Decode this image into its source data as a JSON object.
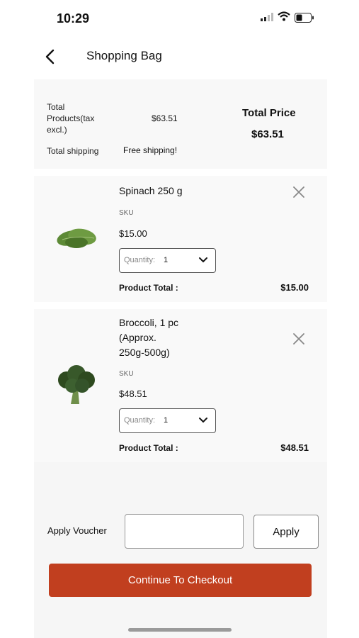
{
  "status_bar": {
    "time": "10:29"
  },
  "header": {
    "title": "Shopping Bag"
  },
  "summary": {
    "total_products_label": "Total\nProducts(tax\nexcl.)",
    "total_products_value": "$63.51",
    "total_shipping_label": "Total shipping",
    "total_shipping_value": "Free shipping!",
    "total_price_label": "Total Price",
    "total_price_value": "$63.51"
  },
  "items": [
    {
      "name": "Spinach 250 g",
      "sku": "SKU",
      "price": "$15.00",
      "quantity_label": "Quantity:",
      "quantity_value": "1",
      "total_label": "Product Total :",
      "total_value": "$15.00"
    },
    {
      "name": "Broccoli, 1 pc\n(Approx.\n250g-500g)",
      "sku": "SKU",
      "price": "$48.51",
      "quantity_label": "Quantity:",
      "quantity_value": "1",
      "total_label": "Product Total :",
      "total_value": "$48.51"
    }
  ],
  "voucher": {
    "label": "Apply Voucher",
    "input_value": "",
    "apply_label": "Apply"
  },
  "checkout": {
    "label": "Continue To Checkout"
  },
  "colors": {
    "accent": "#c13f1f",
    "panel": "#f8f8f8"
  }
}
